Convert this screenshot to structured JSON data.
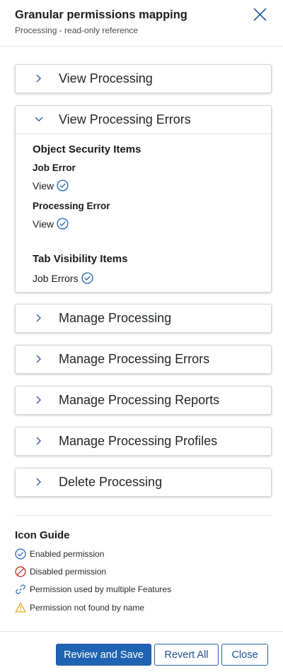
{
  "header": {
    "title": "Granular permissions mapping",
    "subtitle": "Processing - read-only reference"
  },
  "panels": [
    {
      "label": "View Processing",
      "expanded": false
    },
    {
      "label": "View Processing Errors",
      "expanded": true
    },
    {
      "label": "Manage Processing",
      "expanded": false
    },
    {
      "label": "Manage Processing Errors",
      "expanded": false
    },
    {
      "label": "Manage Processing Reports",
      "expanded": false
    },
    {
      "label": "Manage Processing Profiles",
      "expanded": false
    },
    {
      "label": "Delete Processing",
      "expanded": false
    }
  ],
  "expanded_content": {
    "object_security_heading": "Object Security Items",
    "job_error_label": "Job Error",
    "job_error_perm": "View",
    "processing_error_label": "Processing Error",
    "processing_error_perm": "View",
    "tab_visibility_heading": "Tab Visibility Items",
    "tab_visibility_perm": "Job Errors"
  },
  "icon_guide": {
    "title": "Icon Guide",
    "items": [
      {
        "icon": "check-circle-icon",
        "label": "Enabled permission",
        "color": "#1f63b3"
      },
      {
        "icon": "prohibited-icon",
        "label": "Disabled permission",
        "color": "#b3261e"
      },
      {
        "icon": "link-icon",
        "label": "Permission used by multiple Features",
        "color": "#1f63b3"
      },
      {
        "icon": "warning-icon",
        "label": "Permission not found by name",
        "color": "#e0a400"
      }
    ]
  },
  "footer": {
    "review_save": "Review and Save",
    "revert_all": "Revert All",
    "close": "Close"
  },
  "colors": {
    "accent": "#1f63b3",
    "border": "#cfd5db"
  }
}
